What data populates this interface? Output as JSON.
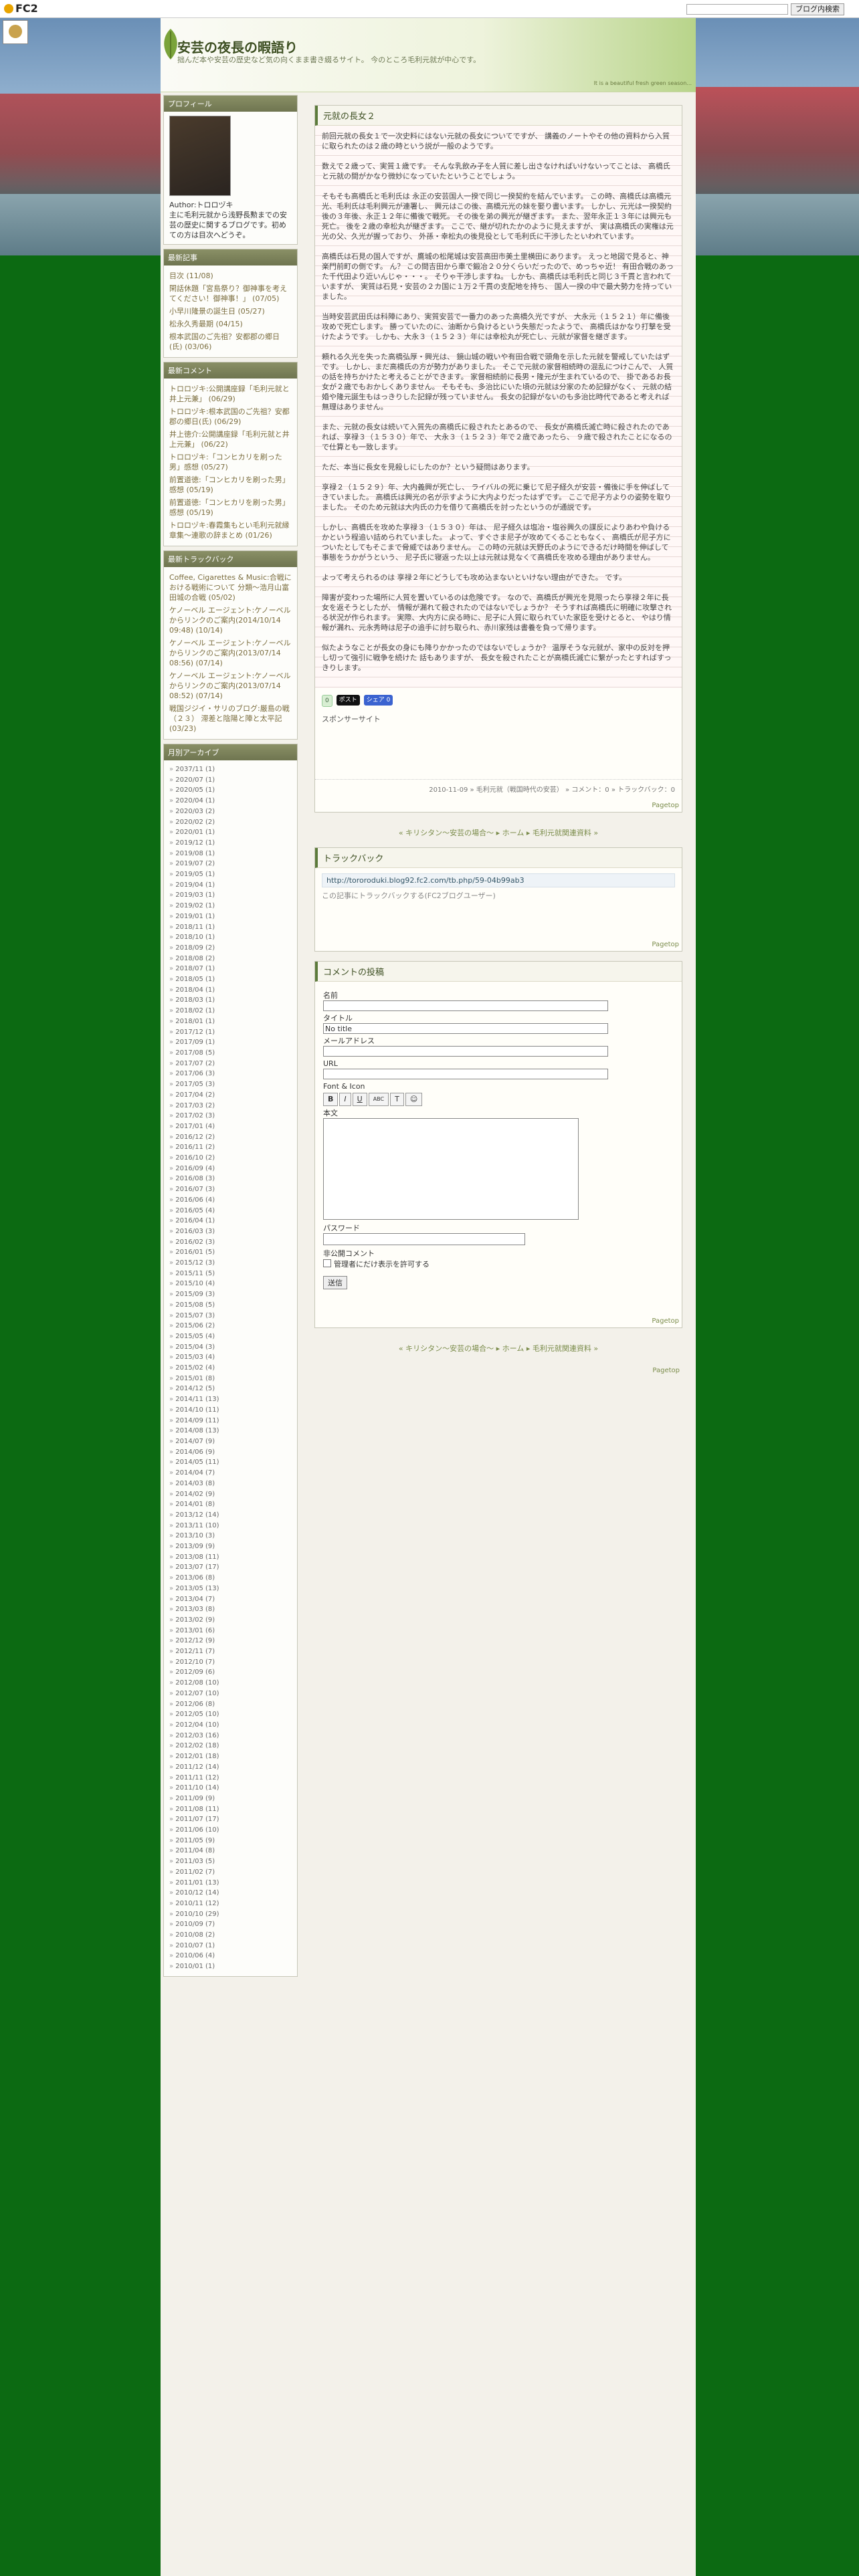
{
  "topbar": {
    "logo": "FC2",
    "search_placeholder": "",
    "search_button": "ブログ内検索"
  },
  "header": {
    "title": "安芸の夜長の暇語り",
    "description": "拙んだ本や安芸の歴史など気の向くまま書き綴るサイト。 今のところ毛利元就が中心です。",
    "tagline": "It is a beautiful fresh green season..."
  },
  "sidebar": {
    "profile": {
      "heading": "プロフィール",
      "author": "Author:トロロヅキ",
      "bio": "主に毛利元就から浅野長勲までの安芸の歴史に関するブログです。初めての方は目次へどうぞ。"
    },
    "recent_entries": {
      "heading": "最新記事",
      "items": [
        "目次 (11/08)",
        "閑話休題「宮島祭り？御神事を考えてください！御神事！」 (07/05)",
        "小早川隆景の誕生日 (05/27)",
        "松永久秀最期 (04/15)",
        "根本武国のご先祖？安都郡の郷日(氏) (03/06)"
      ]
    },
    "recent_comments": {
      "heading": "最新コメント",
      "items": [
        "トロロヅキ:公開講座録「毛利元就と井上元兼」 (06/29)",
        "トロロヅキ:根本武国のご先祖？安都郡の郷日(氏) (06/29)",
        "井上徳介:公開講座録「毛利元就と井上元兼」 (06/22)",
        "トロロヅキ:「コンヒカリを刷った男」感想 (05/27)",
        "前置道徳:「コンヒカリを刷った男」感想 (05/19)",
        "前置道徳:「コンヒカリを刷った男」感想 (05/19)",
        "トロロヅキ:春霞集もとい毛利元就縁章集～連歌の辞まとめ (01/26)"
      ]
    },
    "recent_trackbacks": {
      "heading": "最新トラックバック",
      "items": [
        "Coffee, Cigarettes & Music:合戦における戦術について 分類～浩月山富田城の合戦 (05/02)",
        "ケノーベル エージェント:ケノーベルからリンクのご案内(2014/10/14 09:48) (10/14)",
        "ケノーベル エージェント:ケノーベルからリンクのご案内(2013/07/14 08:56) (07/14)",
        "ケノーベル エージェント:ケノーベルからリンクのご案内(2013/07/14 08:52) (07/14)",
        "戦国ジジイ・サリのブログ:厳島の戦（２３） 滞差と陰陽と陣と太平記 (03/23)"
      ]
    },
    "archive": {
      "heading": "月別アーカイブ",
      "items": [
        "2037/11 (1)",
        "2020/07 (1)",
        "2020/05 (1)",
        "2020/04 (1)",
        "2020/03 (2)",
        "2020/02 (2)",
        "2020/01 (1)",
        "2019/12 (1)",
        "2019/08 (1)",
        "2019/07 (2)",
        "2019/05 (1)",
        "2019/04 (1)",
        "2019/03 (1)",
        "2019/02 (1)",
        "2019/01 (1)",
        "2018/11 (1)",
        "2018/10 (1)",
        "2018/09 (2)",
        "2018/08 (2)",
        "2018/07 (1)",
        "2018/05 (1)",
        "2018/04 (1)",
        "2018/03 (1)",
        "2018/02 (1)",
        "2018/01 (1)",
        "2017/12 (1)",
        "2017/09 (1)",
        "2017/08 (5)",
        "2017/07 (2)",
        "2017/06 (3)",
        "2017/05 (3)",
        "2017/04 (2)",
        "2017/03 (2)",
        "2017/02 (3)",
        "2017/01 (4)",
        "2016/12 (2)",
        "2016/11 (2)",
        "2016/10 (2)",
        "2016/09 (4)",
        "2016/08 (3)",
        "2016/07 (3)",
        "2016/06 (4)",
        "2016/05 (4)",
        "2016/04 (1)",
        "2016/03 (3)",
        "2016/02 (3)",
        "2016/01 (5)",
        "2015/12 (3)",
        "2015/11 (5)",
        "2015/10 (4)",
        "2015/09 (3)",
        "2015/08 (5)",
        "2015/07 (3)",
        "2015/06 (2)",
        "2015/05 (4)",
        "2015/04 (3)",
        "2015/03 (4)",
        "2015/02 (4)",
        "2015/01 (8)",
        "2014/12 (5)",
        "2014/11 (13)",
        "2014/10 (11)",
        "2014/09 (11)",
        "2014/08 (13)",
        "2014/07 (9)",
        "2014/06 (9)",
        "2014/05 (11)",
        "2014/04 (7)",
        "2014/03 (8)",
        "2014/02 (9)",
        "2014/01 (8)",
        "2013/12 (14)",
        "2013/11 (10)",
        "2013/10 (3)",
        "2013/09 (9)",
        "2013/08 (11)",
        "2013/07 (17)",
        "2013/06 (8)",
        "2013/05 (13)",
        "2013/04 (7)",
        "2013/03 (8)",
        "2013/02 (9)",
        "2013/01 (6)",
        "2012/12 (9)",
        "2012/11 (7)",
        "2012/10 (7)",
        "2012/09 (6)",
        "2012/08 (10)",
        "2012/07 (10)",
        "2012/06 (8)",
        "2012/05 (10)",
        "2012/04 (10)",
        "2012/03 (16)",
        "2012/02 (18)",
        "2012/01 (18)",
        "2011/12 (14)",
        "2011/11 (12)",
        "2011/10 (14)",
        "2011/09 (9)",
        "2011/08 (11)",
        "2011/07 (17)",
        "2011/06 (10)",
        "2011/05 (9)",
        "2011/04 (8)",
        "2011/03 (5)",
        "2011/02 (7)",
        "2011/01 (13)",
        "2010/12 (14)",
        "2010/11 (12)",
        "2010/10 (29)",
        "2010/09 (7)",
        "2010/08 (2)",
        "2010/07 (1)",
        "2010/06 (4)",
        "2010/01 (1)"
      ]
    }
  },
  "entry": {
    "title": "元就の長女２",
    "paragraphs": [
      "前回元就の長女１で一次史料にはない元就の長女についてですが、 講義のノートやその他の資料から入質に取られたのは２歳の時という説が一般のようです。",
      "数えで２歳って、実質１歳です。 そんな乳飲み子を人質に差し出さなければいけないってことは、 高橋氏と元就の間がかなり微妙になっていたということでしょう。",
      "そもそも高橋氏と毛利氏は 永正の安芸国人一揆で同じ一揆契約を結んでいます。 この時、高橋氏は高橋元光、毛利氏は毛利興元が連署し、 興元はこの後、高橋元光の妹を娶り書います。 しかし、元光は一揆契約後の３年後、永正１２年に備後で戦死。 その後を弟の興光が継ぎます。 また、翌年永正１３年には興元も死亡。 後を２歳の幸松丸が継ぎます。 ここで、継が切れたかのように見えますが、 実は高橋氏の実権は元光の父、久光が握っており、 外孫・幸松丸の後見役として毛利氏に干渉したといわれています。",
      "高橋氏は石見の国人ですが、鷹城の松尾城は安芸高田市美土里横田にあります。 えっと地図で見ると、神楽門前町の側です。 ん？ この間吉田から車で鍛冶２０分くらいだったので、めっちゃ近！ 有田合戦のあった千代田より近いんじゃ・・・。 そりゃ干渉しますね。 しかも、高橋氏は毛利氏と同じ３千貫と言われていますが、 実質は石見・安芸の２カ国に１万２千貫の支配地を持ち、 国人一揆の中で最大勢力を持っていました。",
      "当時安芸武田氏は科陣にあり、実質安芸で一番力のあった高橋久光ですが、 大永元（１５２１）年に備後攻めで死亡します。 勝っていたのに、油断から負けるという失態だったようで、 高橋氏はかなり打撃を受けたようです。 しかも、大永３（１５２３）年には幸松丸が死亡し、元就が家督を継ぎます。",
      "頼れる久光を失った高橋弘厚・興光は、 鏡山城の戦いや有田合戦で頭角を示した元就を警戒していたはずです。 しかし、まだ高橋氏の方が勢力がありました。 そこで元就の家督相続時の混乱につけこんで、 人質の話を持ちかけたと考えることができます。 家督相続前に長男・隆元が生まれているので、 掛であるお長女が２歳でもおかしくありません。 そもそも、多治比にいた頃の元就は分家のため記録がなく、 元就の結婚や隆元誕生もはっきりした記録が残っていません。 長女の記録がないのも多治比時代であると考えれば無理はありません。",
      "また、元就の長女は続いて入質先の高橋氏に殺されたとあるので、 長女が高橋氏滅亡時に殺されたのであれば、享禄３（１５３０）年で、 大永３（１５２３）年で２歳であったら、 ９歳で殺されたことになるので仕算とも一致します。",
      "ただ、本当に長女を見殺しにしたのか？という疑問はあります。",
      "享禄２（１５２９）年、大内義興が死亡し、 ライバルの死に乗じて尼子経久が安芸・備後に手を伸ばしてきていました。 高橋氏は興光の名が示すように大内よりだったはずです。 ここで尼子方よりの姿勢を取りました。 そのため元就は大内氏の力を借りて高橋氏を討ったというのが通説です。",
      "しかし、高橋氏を攻めた享禄３（１５３０）年は、 尼子経久は塩冶・塩谷興久の謀反によりあわや負けるかという程追い詰められていました。 よって、すぐさま尼子が攻めてくることもなく、 高橋氏が尼子方についたとしてもそこまで脅威ではありません。 この時の元就は天野氏のようにできるだけ時間を伸ばして事態をうかがうという、 尼子氏に寝返った以上は元就は見なくて高橋氏を攻める理由がありません。",
      "よって考えられるのは 享禄２年にどうしても攻め込まないといけない理由ができた。 です。",
      "障害が変わった場所に人質を置いているのは危険です。 なので、高橋氏が興光を見限ったら享禄２年に長女を返そうとしたが、 情報が漏れて殺されたのではないでしょうか？ そうすれば高橋氏に明確に攻撃される状況が作られます。 実際、大内方に戻る時に、尼子に人質に取られていた家臣を受けとると、 やはり情報が漏れ、元永秀時は尼子の追手に討ち取られ、赤川家残は書養を負って帰ります。",
      "似たようなことが長女の身にも降りかかったのではないでしょうか？ 温厚そうな元就が、家中の反対を押し切って強引に戦争を続けた 話もありますが、 長女を殺されたことが高橋氏滅亡に繋がったとすればすっきりします。"
    ],
    "social": {
      "like": "0",
      "tweet": "ポスト",
      "fb_share": "シェア 0"
    },
    "sponsor": "スポンサーサイト",
    "footer": "2010-11-09 » 毛利元就（戦国時代の安芸） » コメント：0 » トラックバック：0",
    "pagetop": "Pagetop"
  },
  "nav": {
    "prev": "« キリシタン〜安芸の場合〜",
    "home": "ホーム",
    "next": "毛利元就関連資料 »"
  },
  "trackback": {
    "heading": "トラックバック",
    "url": "http://tororoduki.blog92.fc2.com/tb.php/59-04b99ab3",
    "link": "この記事にトラックバックする(FC2ブログユーザー)",
    "pagetop": "Pagetop"
  },
  "comment_form": {
    "heading": "コメントの投稿",
    "name_label": "名前",
    "title_label": "タイトル",
    "title_value": "No title",
    "email_label": "メールアドレス",
    "url_label": "URL",
    "toolbar_label": "Font & Icon",
    "toolbar": [
      "B",
      "I",
      "U",
      "ABC",
      "T",
      "☺"
    ],
    "body_label": "本文",
    "password_label": "パスワード",
    "private_label": "非公開コメント",
    "private_option": "管理者にだけ表示を許可する",
    "submit": "送信",
    "pagetop": "Pagetop"
  },
  "nav2": {
    "prev": "« キリシタン〜安芸の場合〜",
    "home": "ホーム",
    "next": "毛利元就関連資料 »",
    "pagetop": "Pagetop"
  }
}
